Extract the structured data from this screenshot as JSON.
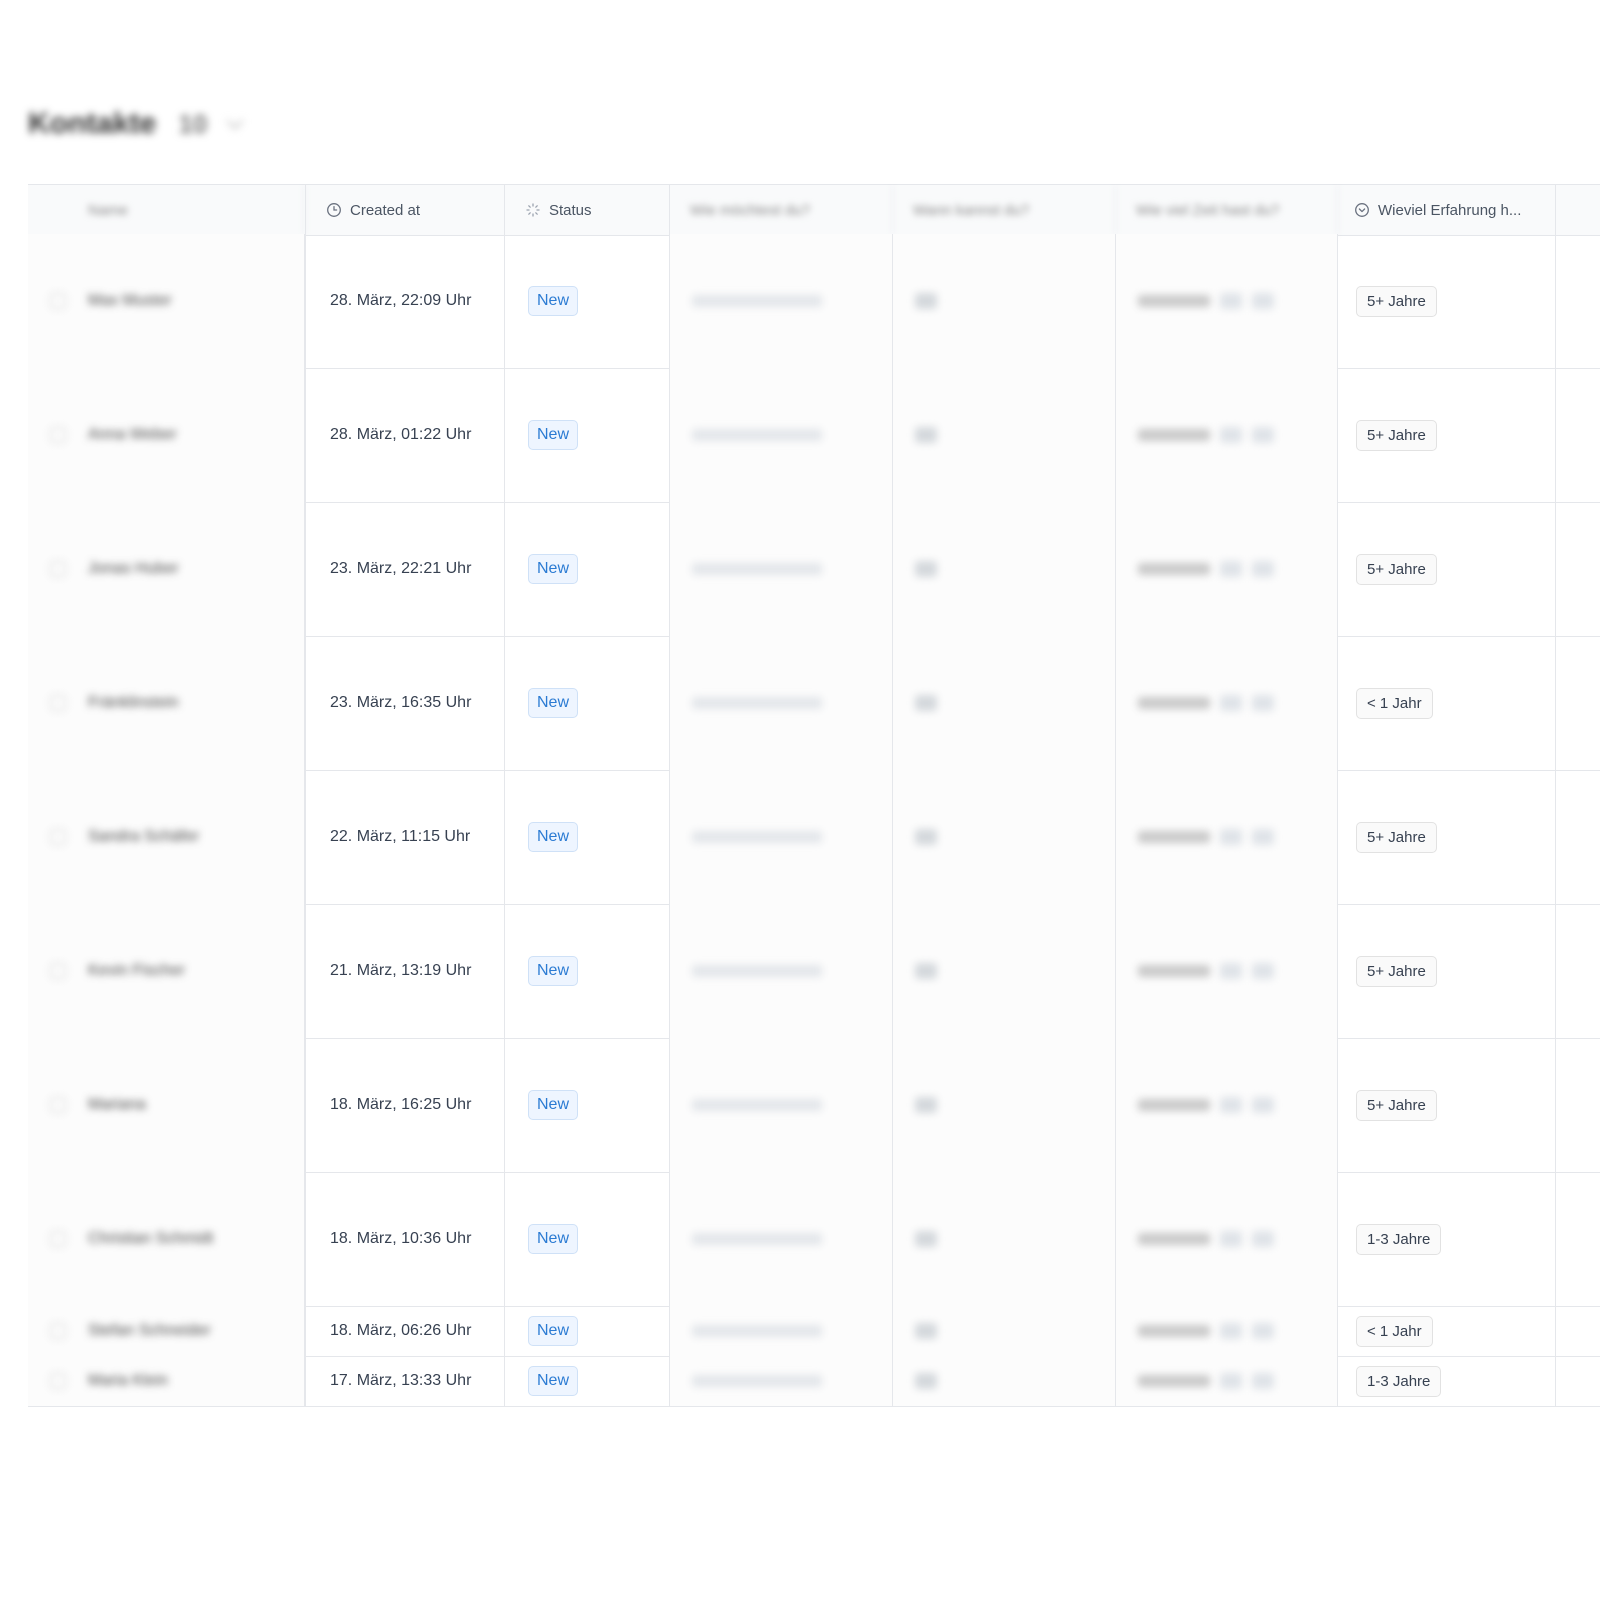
{
  "page": {
    "title": "Kontakte",
    "count": "10"
  },
  "columns": {
    "name": "Name",
    "created_at": "Created at",
    "status": "Status",
    "col4": "Wie möchtest du?",
    "col5": "Wann kannst du?",
    "col6": "Wie viel Zeit hast du?",
    "experience": "Wieviel Erfahrung h..."
  },
  "rows": [
    {
      "name": "Max Muster",
      "created_at": "28. März, 22:09 Uhr",
      "status": "New",
      "experience": "5+ Jahre"
    },
    {
      "name": "Anna Weber",
      "created_at": "28. März, 01:22 Uhr",
      "status": "New",
      "experience": "5+ Jahre"
    },
    {
      "name": "Jonas Huber",
      "created_at": "23. März, 22:21 Uhr",
      "status": "New",
      "experience": "5+ Jahre"
    },
    {
      "name": "Fränklinstein",
      "created_at": "23. März, 16:35 Uhr",
      "status": "New",
      "experience": "< 1 Jahr"
    },
    {
      "name": "Sandra Schäfer",
      "created_at": "22. März, 11:15 Uhr",
      "status": "New",
      "experience": "5+ Jahre"
    },
    {
      "name": "Kevin Fischer",
      "created_at": "21. März, 13:19 Uhr",
      "status": "New",
      "experience": "5+ Jahre"
    },
    {
      "name": "Mariana",
      "created_at": "18. März, 16:25 Uhr",
      "status": "New",
      "experience": "5+ Jahre"
    },
    {
      "name": "Christian Schmidt",
      "created_at": "18. März, 10:36 Uhr",
      "status": "New",
      "experience": "1-3 Jahre"
    },
    {
      "name": "Stefan Schneider",
      "created_at": "18. März, 06:26 Uhr",
      "status": "New",
      "experience": "< 1 Jahr"
    },
    {
      "name": "Maria Klein",
      "created_at": "17. März, 13:33 Uhr",
      "status": "New",
      "experience": "1-3 Jahre"
    }
  ]
}
